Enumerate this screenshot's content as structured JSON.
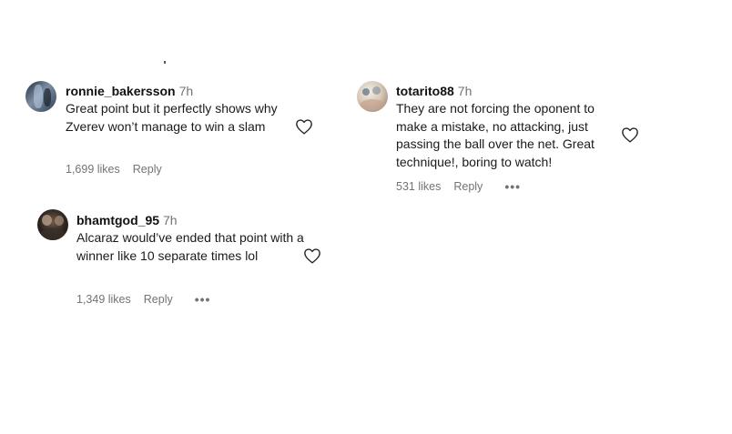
{
  "comments": [
    {
      "username": "ronnie_bakersson",
      "time": "7h",
      "text": "Great point but it perfectly shows why Zverev won’t manage to win a slam",
      "likes": "1,699 likes",
      "reply": "Reply"
    },
    {
      "username": "totarito88",
      "time": "7h",
      "text": "They are not forcing the oponent to make a mistake, no attacking, just passing the ball over the net. Great technique!, boring to watch!",
      "likes": "531 likes",
      "reply": "Reply",
      "more": "•••"
    },
    {
      "username": "bhamtgod_95",
      "time": "7h",
      "text": "Alcaraz would’ve ended that point with a winner like 10 separate times lol",
      "likes": "1,349 likes",
      "reply": "Reply",
      "more": "•••"
    }
  ],
  "icons": {
    "like": "heart-outline-icon",
    "more": "more-options-icon"
  },
  "colors": {
    "text": "#111111",
    "muted": "#737373",
    "icon": "#262626"
  }
}
